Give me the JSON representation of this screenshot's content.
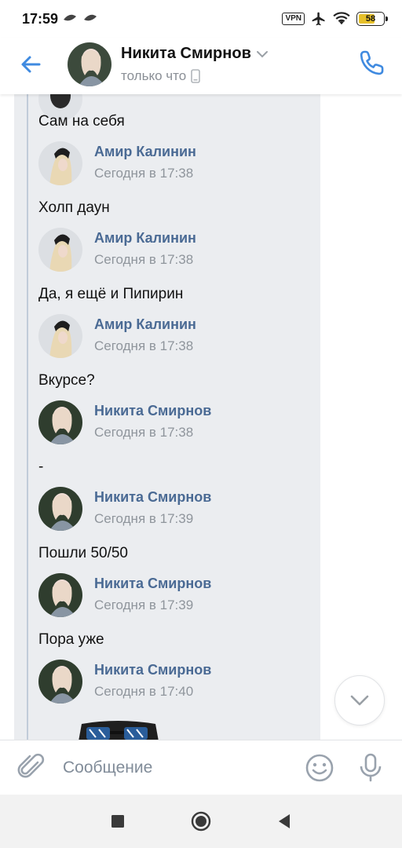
{
  "status_bar": {
    "time": "17:59",
    "vpn_label": "VPN",
    "battery": "58"
  },
  "header": {
    "contact_name": "Никита Смирнов",
    "status": "только что",
    "status_device_icon": "phone-icon"
  },
  "messages": [
    {
      "type": "text",
      "text": "Сам на себя"
    },
    {
      "type": "forward",
      "name": "Амир Калинин",
      "time": "Сегодня в 17:38"
    },
    {
      "type": "text",
      "text": "Холп даун"
    },
    {
      "type": "forward",
      "name": "Амир Калинин",
      "time": "Сегодня в 17:38"
    },
    {
      "type": "text",
      "text": "Да, я ещё и Пипирин"
    },
    {
      "type": "forward",
      "name": "Амир Калинин",
      "time": "Сегодня в 17:38"
    },
    {
      "type": "text",
      "text": "Вкурсе?"
    },
    {
      "type": "forward",
      "name": "Никита Смирнов",
      "time": "Сегодня в 17:38"
    },
    {
      "type": "text",
      "text": "-"
    },
    {
      "type": "forward",
      "name": "Никита Смирнов",
      "time": "Сегодня в 17:39"
    },
    {
      "type": "text",
      "text": "Пошли 50/50"
    },
    {
      "type": "forward",
      "name": "Никита Смирнов",
      "time": "Сегодня в 17:39"
    },
    {
      "type": "text",
      "text": "Пора уже"
    },
    {
      "type": "forward",
      "name": "Никита Смирнов",
      "time": "Сегодня в 17:40"
    }
  ],
  "composer": {
    "placeholder": "Сообщение"
  },
  "colors": {
    "accent": "#3f8ae0",
    "link_name": "#4a6a94",
    "forward_bg": "#ebedf0",
    "forward_line": "#c1ccd9"
  }
}
